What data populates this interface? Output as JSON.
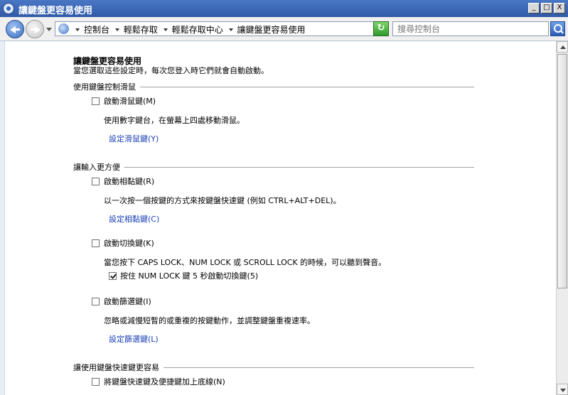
{
  "window": {
    "title": "讓鍵盤更容易使用",
    "minimize": "_",
    "maximize": "□",
    "close": "X"
  },
  "address": {
    "crumbs": [
      "控制台",
      "輕鬆存取",
      "輕鬆存取中心",
      "讓鍵盤更容易使用"
    ],
    "refresh_glyph": "↻",
    "search_placeholder": "搜尋控制台"
  },
  "page": {
    "title": "讓鍵盤更容易使用",
    "subtitle": "當您選取這些設定時，每次您登入時它們就會自動啟動。"
  },
  "sections": {
    "mouse": {
      "heading": "使用鍵盤控制滑鼠",
      "mousekeys": {
        "label": "啟動滑鼠鍵(M)",
        "checked": false
      },
      "mousekeys_desc": "使用數字鍵台，在螢幕上四處移動滑鼠。",
      "mousekeys_link": "設定滑鼠鍵(Y)"
    },
    "typing": {
      "heading": "讓輸入更方便",
      "stickykeys": {
        "label": "啟動相黏鍵(R)",
        "checked": false
      },
      "stickykeys_desc": "以一次按一個按鍵的方式來按鍵盤快速鍵 (例如 CTRL+ALT+DEL)。",
      "stickykeys_link": "設定相黏鍵(C)",
      "togglekeys": {
        "label": "啟動切換鍵(K)",
        "checked": false
      },
      "togglekeys_desc": "當您按下 CAPS LOCK、NUM LOCK 或 SCROLL LOCK 的時候，可以聽到聲音。",
      "togglekeys_hold": {
        "label": "按住 NUM LOCK 鍵 5 秒啟動切換鍵(5)",
        "checked": true
      },
      "filterkeys": {
        "label": "啟動篩選鍵(I)",
        "checked": false
      },
      "filterkeys_desc": "忽略或減慢短暫的或重複的按鍵動作，並調整鍵盤重複速率。",
      "filterkeys_link": "設定篩選鍵(L)"
    },
    "shortcuts": {
      "heading": "讓使用鍵盤快速鍵更容易",
      "underline": {
        "label": "將鍵盤快速鍵及便捷鍵加上底線(N)",
        "checked": false
      }
    }
  }
}
